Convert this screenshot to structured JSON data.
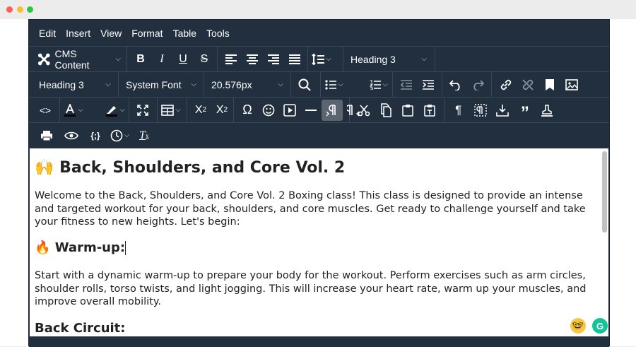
{
  "menubar": {
    "items": [
      "Edit",
      "Insert",
      "View",
      "Format",
      "Table",
      "Tools"
    ]
  },
  "toolbar": {
    "cms_label": "CMS Content",
    "block_format_1": "Heading 3",
    "block_format_2": "Heading 3",
    "font_family": "System Font",
    "font_size": "20.576px",
    "source_code": "<>",
    "special_char": "Ω",
    "bold": "B",
    "italic": "I",
    "underline": "U",
    "strike": "S",
    "paragraph": "¶",
    "blockquote": "”",
    "clear": "T",
    "code_sample": "{;}"
  },
  "document": {
    "title_emoji": "🙌",
    "title": "Back, Shoulders, and Core Vol. 2",
    "intro": "Welcome to the Back, Shoulders, and Core Vol. 2 Boxing class! This class is designed to provide an intense and targeted workout for your back, shoulders, and core muscles. Get ready to challenge yourself and take your fitness to new heights. Let's begin:",
    "warmup_emoji": "🔥",
    "warmup_heading": "Warm-up:",
    "warmup_text": "Start with a dynamic warm-up to prepare your body for the workout. Perform exercises such as arm circles, shoulder rolls, torso twists, and light jogging. This will increase your heart rate, warm up your muscles, and improve overall mobility.",
    "back_heading": "Back Circuit:"
  },
  "floating": {
    "grammarly": "G",
    "emoji_face": "🤓"
  },
  "colors": {
    "toolbar_bg": "#222f3e",
    "active_button": "#5b6570",
    "grammarly_green": "#15c39a"
  }
}
